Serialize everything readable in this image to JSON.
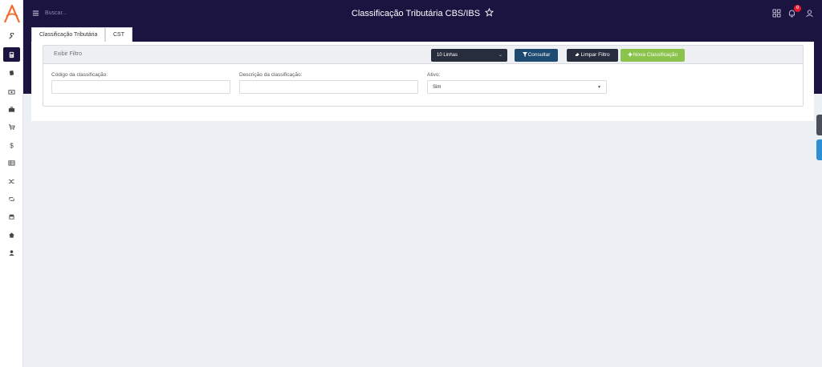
{
  "header": {
    "search_placeholder": "Buscar...",
    "title": "Classificação Tributária CBS/IBS",
    "notification_count": "0"
  },
  "tabs": [
    {
      "label": "Classificação Tributária"
    },
    {
      "label": "CST"
    }
  ],
  "filter": {
    "title": "Exibir Filtro",
    "lines_select": "10 Linhas",
    "consult_label": "Consultar",
    "clear_label": "Limpar Filtro",
    "new_label": "Nova Classificação",
    "fields": {
      "code_label": "Código da classificação:",
      "code_value": "",
      "description_label": "Descrição da classificação:",
      "description_value": "",
      "active_label": "Ativo:",
      "active_value": "Sim"
    }
  },
  "sidebar": {
    "items": [
      {
        "icon": "wrench-icon"
      },
      {
        "icon": "calculator-icon",
        "active": true
      },
      {
        "icon": "book-icon"
      },
      {
        "icon": "money-icon"
      },
      {
        "icon": "briefcase-icon"
      },
      {
        "icon": "cart-icon"
      },
      {
        "icon": "dollar-icon"
      },
      {
        "icon": "table-icon"
      },
      {
        "icon": "shuffle-icon"
      },
      {
        "icon": "retweet-icon"
      },
      {
        "icon": "store-icon"
      },
      {
        "icon": "home-icon"
      },
      {
        "icon": "user-icon"
      }
    ]
  },
  "colors": {
    "header_bg": "#1b1440",
    "logo_accent": "#f26b2a",
    "btn_consult": "#1e4971",
    "btn_dark": "#272d3d",
    "btn_new": "#8cc34c",
    "badge": "#e8192c"
  }
}
